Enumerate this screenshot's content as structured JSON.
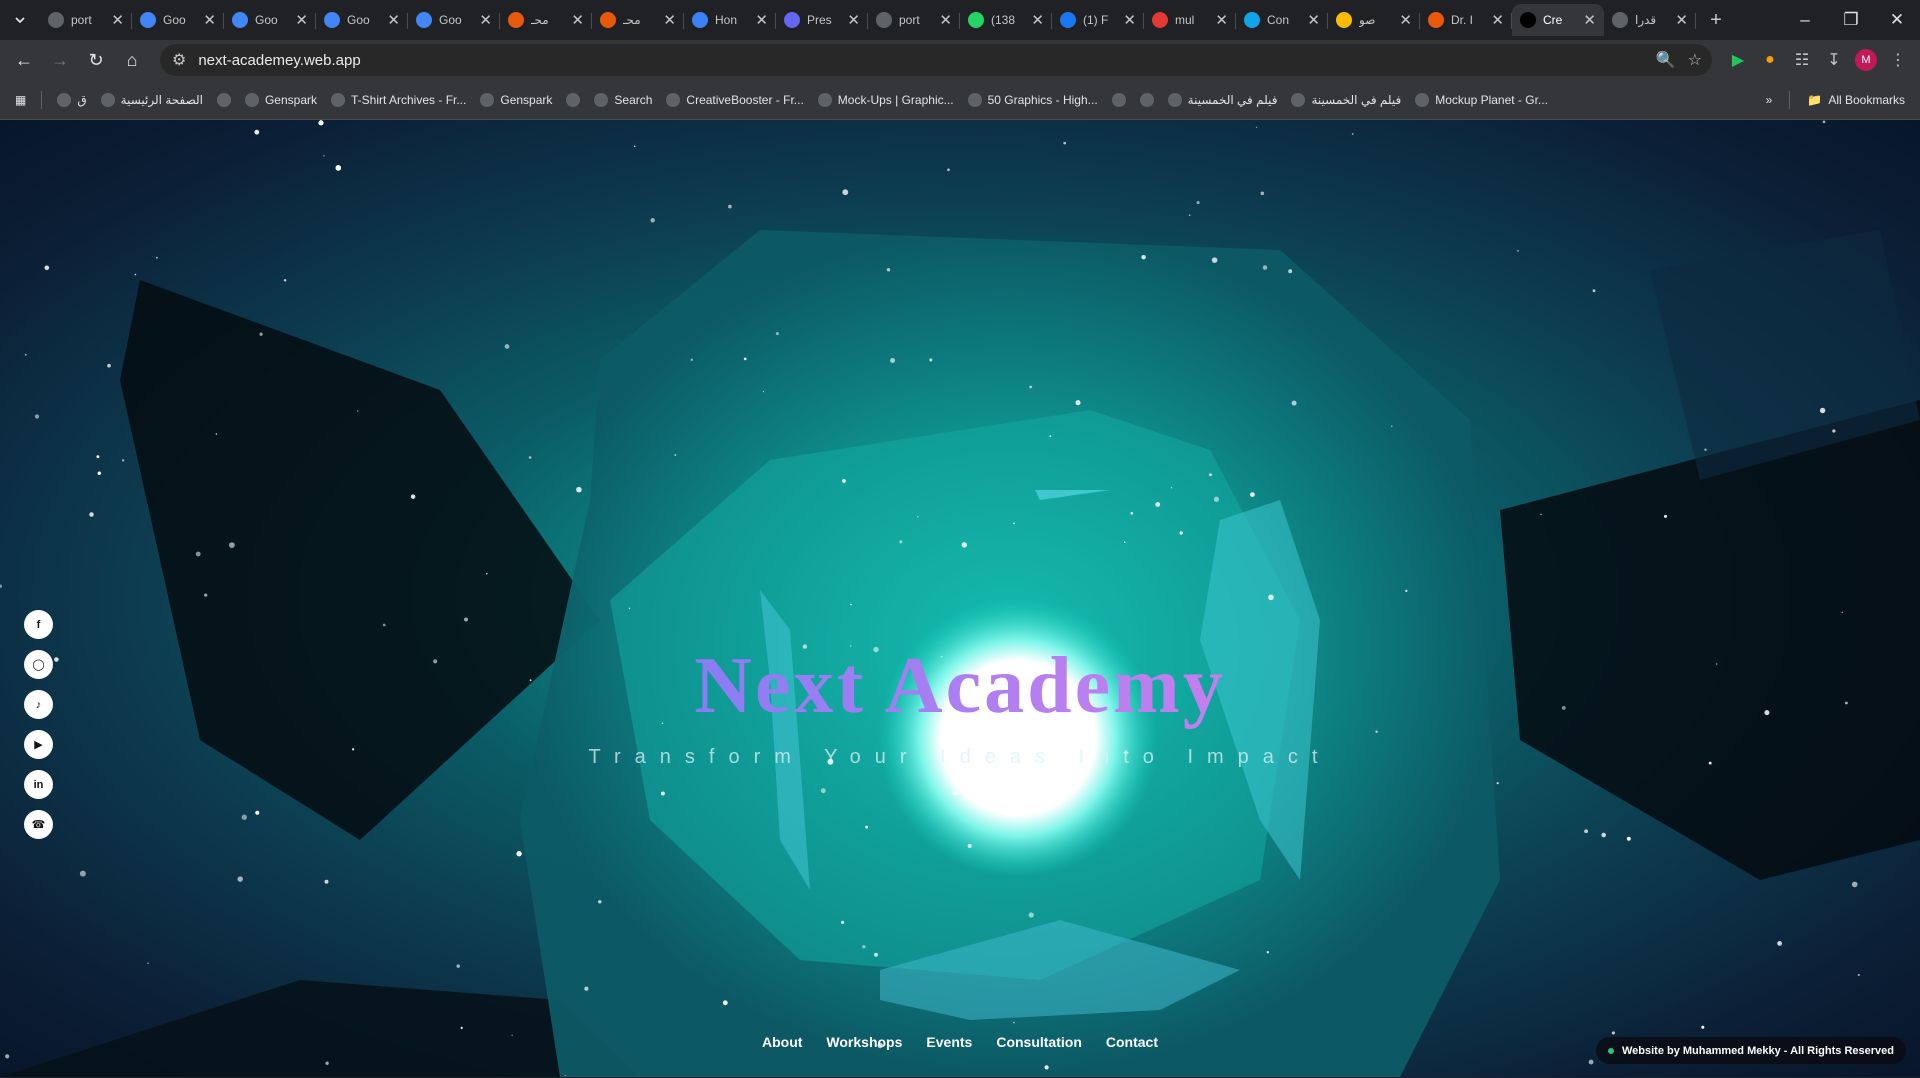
{
  "browser": {
    "tabs": [
      {
        "title": "port",
        "icon": "openai-icon",
        "color": "#5f6368"
      },
      {
        "title": "Goo",
        "icon": "gemini-icon",
        "color": "#4285f4"
      },
      {
        "title": "Goo",
        "icon": "gemini-icon",
        "color": "#4285f4"
      },
      {
        "title": "Goo",
        "icon": "gemini-icon",
        "color": "#4285f4"
      },
      {
        "title": "Goo",
        "icon": "gemini-icon",
        "color": "#4285f4"
      },
      {
        "title": "محـ",
        "icon": "claude-icon",
        "color": "#e8590c"
      },
      {
        "title": "محـ",
        "icon": "claude-icon",
        "color": "#e8590c"
      },
      {
        "title": "Hon",
        "icon": "site-icon",
        "color": "#3b82f6"
      },
      {
        "title": "Pres",
        "icon": "shield-icon",
        "color": "#6366f1"
      },
      {
        "title": "port",
        "icon": "openai-icon",
        "color": "#5f6368"
      },
      {
        "title": "(138",
        "icon": "whatsapp-icon",
        "color": "#25d366"
      },
      {
        "title": "(1) F",
        "icon": "facebook-icon",
        "color": "#1877f2"
      },
      {
        "title": "mul",
        "icon": "site-icon",
        "color": "#e53935"
      },
      {
        "title": "Con",
        "icon": "copilot-icon",
        "color": "#0ea5e9"
      },
      {
        "title": "صو",
        "icon": "photos-icon",
        "color": "#fbbc04"
      },
      {
        "title": "Dr. I",
        "icon": "claude-icon",
        "color": "#e8590c"
      },
      {
        "title": "Cre",
        "icon": "vercel-icon",
        "color": "#000000",
        "active": true
      },
      {
        "title": "قدرا",
        "icon": "site-icon",
        "color": "#5f6368"
      }
    ],
    "url": "next-academey.web.app",
    "profile_initial": "M",
    "bookmarks": [
      {
        "label": "ق",
        "icon": "folder-icon"
      },
      {
        "label": "الصفحة الرئيسية",
        "icon": "instagram-icon"
      },
      {
        "label": "",
        "icon": "globe-icon"
      },
      {
        "label": "Genspark",
        "icon": "genspark-icon"
      },
      {
        "label": "T-Shirt Archives - Fr...",
        "icon": "site-icon"
      },
      {
        "label": "Genspark",
        "icon": "genspark-icon"
      },
      {
        "label": "",
        "icon": "globe-icon"
      },
      {
        "label": "Search",
        "icon": "site-icon"
      },
      {
        "label": "CreativeBooster - Fr...",
        "icon": "site-icon"
      },
      {
        "label": "Mock-Ups | Graphic...",
        "icon": "site-icon"
      },
      {
        "label": "50 Graphics - High...",
        "icon": "site-icon"
      },
      {
        "label": "",
        "icon": "site-icon"
      },
      {
        "label": "",
        "icon": "youtube-icon"
      },
      {
        "label": "فيلم في الخمسينة",
        "icon": "globe-icon"
      },
      {
        "label": "فيلم في الخمسينة",
        "icon": "globe-icon"
      },
      {
        "label": "Mockup Planet - Gr...",
        "icon": "site-icon"
      }
    ],
    "all_bookmarks": "All Bookmarks"
  },
  "site": {
    "title": "Next Academy",
    "subtitle": "Transform Your Ideas Into Impact",
    "social": [
      "facebook-icon",
      "instagram-icon",
      "tiktok-icon",
      "youtube-icon",
      "linkedin-icon",
      "whatsapp-icon"
    ],
    "nav": [
      "About",
      "Workshops",
      "Events",
      "Consultation",
      "Contact"
    ],
    "credit": "Website by Muhammed Mekky - All Rights Reserved"
  }
}
